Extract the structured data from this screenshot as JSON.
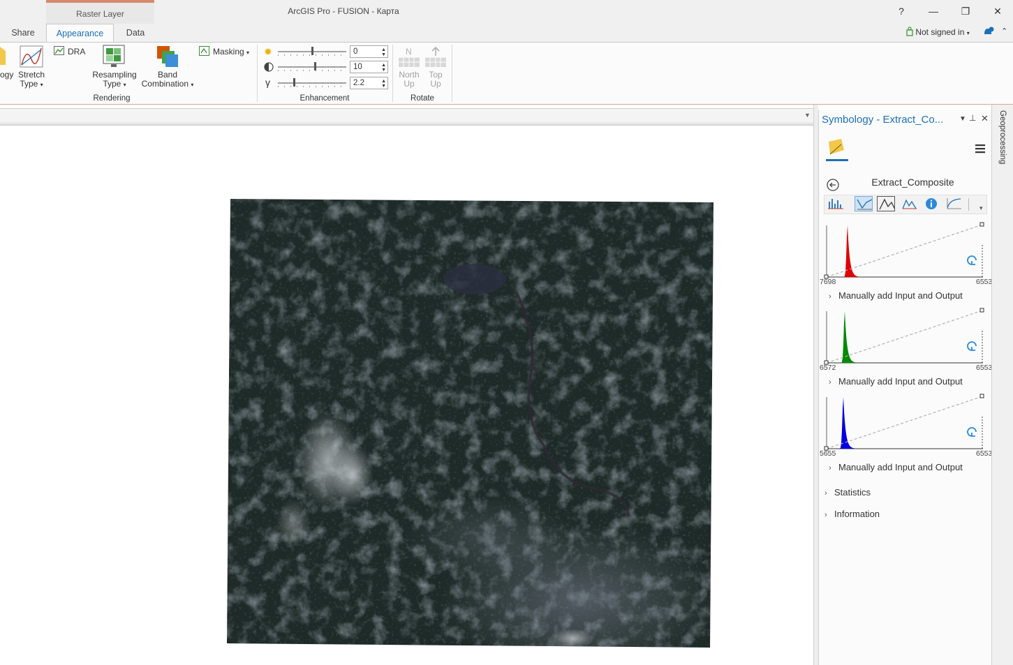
{
  "window": {
    "title": "ArcGIS Pro - FUSION - Карта",
    "context_tab": "Raster Layer",
    "help": "?",
    "minimize": "—",
    "restore": "❐",
    "close": "✕",
    "sign_in": "Not signed in"
  },
  "tabs": [
    {
      "label": "Share",
      "active": false
    },
    {
      "label": "Appearance",
      "active": true
    },
    {
      "label": "Data",
      "active": false
    }
  ],
  "ribbon": {
    "symbology_partial": "ogy",
    "stretch_type": "Stretch",
    "stretch_type2": "Type",
    "dra": "DRA",
    "resampling": "Resampling",
    "resampling2": "Type",
    "band_combination": "Band",
    "band_combination2": "Combination",
    "masking": "Masking",
    "group_rendering": "Rendering",
    "brightness_value": "0",
    "contrast_value": "10",
    "gamma_value": "2.2",
    "brightness_level": 0.5,
    "contrast_level": 0.55,
    "gamma_level": 0.23,
    "group_enhancement": "Enhancement",
    "north_up": "North",
    "north_up2": "Up",
    "top_up": "Top",
    "top_up2": "Up",
    "group_rotate": "Rotate"
  },
  "symbology": {
    "pane_title": "Symbology - Extract_Co...",
    "layer_name": "Extract_Composite",
    "bands": [
      {
        "color": "#e00000",
        "min_label": "7698",
        "max_label": "6553",
        "action": "Manually add Input and Output"
      },
      {
        "color": "#008a00",
        "min_label": "6572",
        "max_label": "6553",
        "action": "Manually add Input and Output"
      },
      {
        "color": "#0000e0",
        "min_label": "5655",
        "max_label": "6553",
        "action": "Manually add Input and Output"
      }
    ],
    "statistics": "Statistics",
    "information": "Information"
  },
  "geoprocessing_tab": "Geoprocessing",
  "colors": {
    "accent": "#1c6fb8",
    "ribbon_border": "#d9a89a",
    "context_tab": "#d68a6b"
  }
}
